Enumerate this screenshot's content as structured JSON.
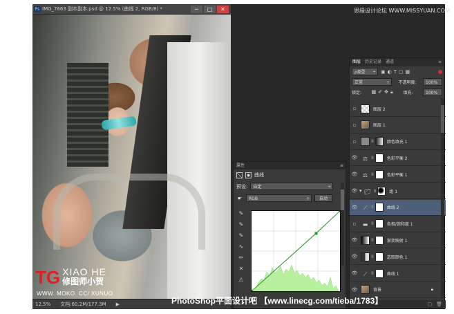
{
  "window": {
    "title": "IMG_7663 副本副本.psd @ 12.5% (曲线 2, RGB/8) *",
    "min": "─",
    "max": "□",
    "close": "✕"
  },
  "watermark_top": "思缘设计论坛 WWW.MISSYUAN.COM",
  "logo": {
    "tg": "TG",
    "xh": "XIAO HE",
    "cn": "修图师小贺",
    "url": "WWW. MOKO. CC/ XUNUO"
  },
  "status": {
    "zoom": "12.5%",
    "doc": "文档:60.2M/177.3M"
  },
  "bottom_watermark": "PhotoShop平面设计吧 【www.linecg.com/tieba/1783】",
  "properties": {
    "tab": "属性",
    "title": "曲线",
    "preset_label": "预设:",
    "preset_value": "自定",
    "channel_value": "RGB",
    "auto_btn": "自动",
    "curve_points": [
      [
        0,
        0
      ],
      [
        0.73,
        0.72
      ],
      [
        1,
        1
      ]
    ]
  },
  "layers_panel": {
    "tabs": [
      "图层",
      "历史记录",
      "通道"
    ],
    "filter": "ρ类型",
    "blend": "正常",
    "opacity_label": "不透明度:",
    "opacity": "100%",
    "lock_label": "锁定:",
    "fill_label": "填充:",
    "fill": "100%",
    "layers": [
      {
        "name": "图层 2",
        "thumb": "checker",
        "eye": false
      },
      {
        "name": "图层 1",
        "thumb": "photo",
        "eye": false
      },
      {
        "name": "颜色填充 1",
        "thumb": "gray",
        "eye": false,
        "mask": true
      },
      {
        "name": "色彩平衡 2",
        "thumb": "balance",
        "eye": true,
        "mask": true
      },
      {
        "name": "色彩平衡 1",
        "thumb": "balance",
        "eye": true,
        "mask": true
      },
      {
        "name": "组 1",
        "thumb": "folder",
        "eye": true,
        "mask": true
      },
      {
        "name": "曲线 2",
        "thumb": "curve",
        "eye": true,
        "mask": true,
        "selected": true
      },
      {
        "name": "色相/饱和度 1",
        "thumb": "hue",
        "eye": false,
        "mask": true
      },
      {
        "name": "渐变映射 1",
        "thumb": "gradient",
        "eye": true,
        "mask": true
      },
      {
        "name": "选取颜色 1",
        "thumb": "selective",
        "eye": true,
        "mask": true
      },
      {
        "name": "曲线 1",
        "thumb": "curve",
        "eye": true,
        "mask": true
      },
      {
        "name": "背景",
        "thumb": "photo",
        "eye": true,
        "lock": true
      }
    ]
  }
}
